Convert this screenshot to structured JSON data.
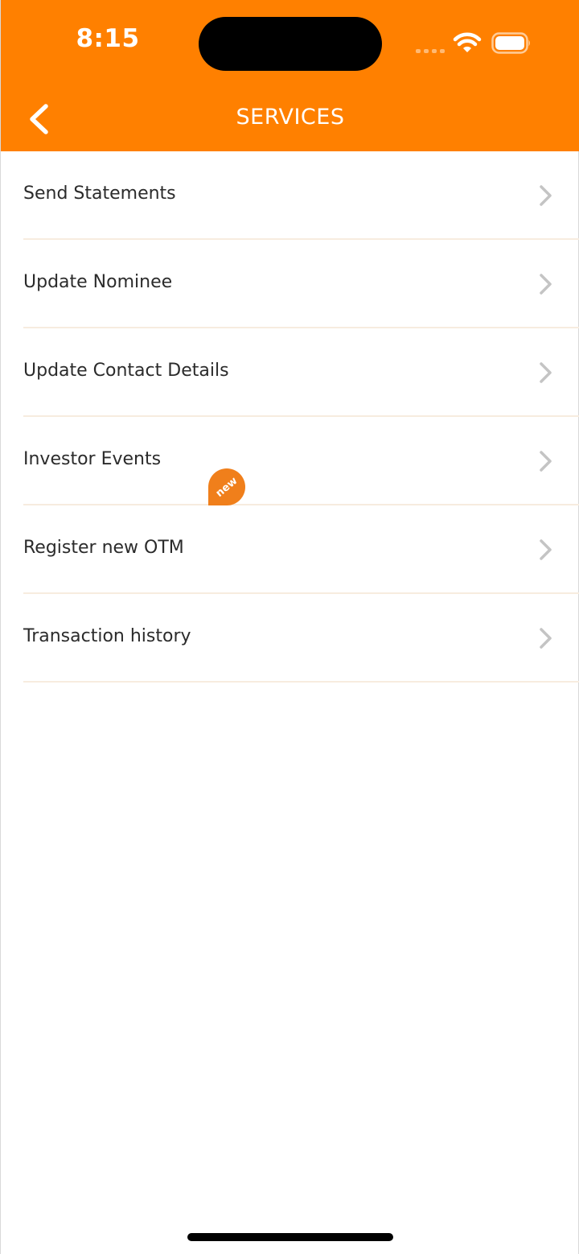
{
  "status_bar": {
    "time": "8:15",
    "icons": [
      "cellular-signal-icon",
      "wifi-icon",
      "battery-icon"
    ]
  },
  "header": {
    "title": "SERVICES",
    "back_icon": "chevron-left-icon",
    "background_color": "#FF8000"
  },
  "menu": {
    "items": [
      {
        "label": "Send Statements"
      },
      {
        "label": "Update Nominee"
      },
      {
        "label": "Update Contact Details"
      },
      {
        "label": "Investor Events"
      },
      {
        "label": "Register new OTM"
      },
      {
        "label": "Transaction history",
        "badge": "new"
      }
    ],
    "chevron_icon": "chevron-right-icon",
    "badge_color": "#F07F1B",
    "divider_color": "#F7ECDF"
  }
}
